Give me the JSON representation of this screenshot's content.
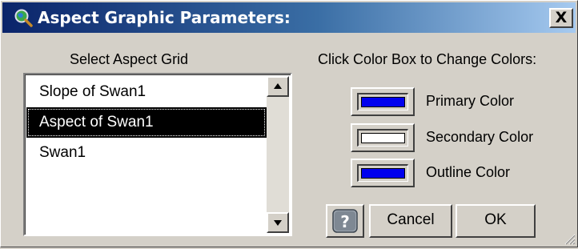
{
  "window": {
    "title": "Aspect Graphic Parameters:",
    "close_label": "X"
  },
  "grid_section": {
    "label": "Select Aspect Grid",
    "items": [
      {
        "label": "Slope of Swan1",
        "selected": false
      },
      {
        "label": "Aspect of Swan1",
        "selected": true
      },
      {
        "label": "Swan1",
        "selected": false
      }
    ]
  },
  "color_section": {
    "label": "Click Color Box to Change Colors:",
    "colors": [
      {
        "label": "Primary Color",
        "value": "#0000ee"
      },
      {
        "label": "Secondary Color",
        "value": "#ffffff"
      },
      {
        "label": "Outline Color",
        "value": "#0000ee"
      }
    ]
  },
  "buttons": {
    "help_icon": "question-icon",
    "cancel_label": "Cancel",
    "ok_label": "OK"
  },
  "icons": {
    "title": "globe-magnifier-icon",
    "scroll_up": "arrow-up-icon",
    "scroll_down": "arrow-down-icon",
    "resize": "resize-grip-icon"
  }
}
